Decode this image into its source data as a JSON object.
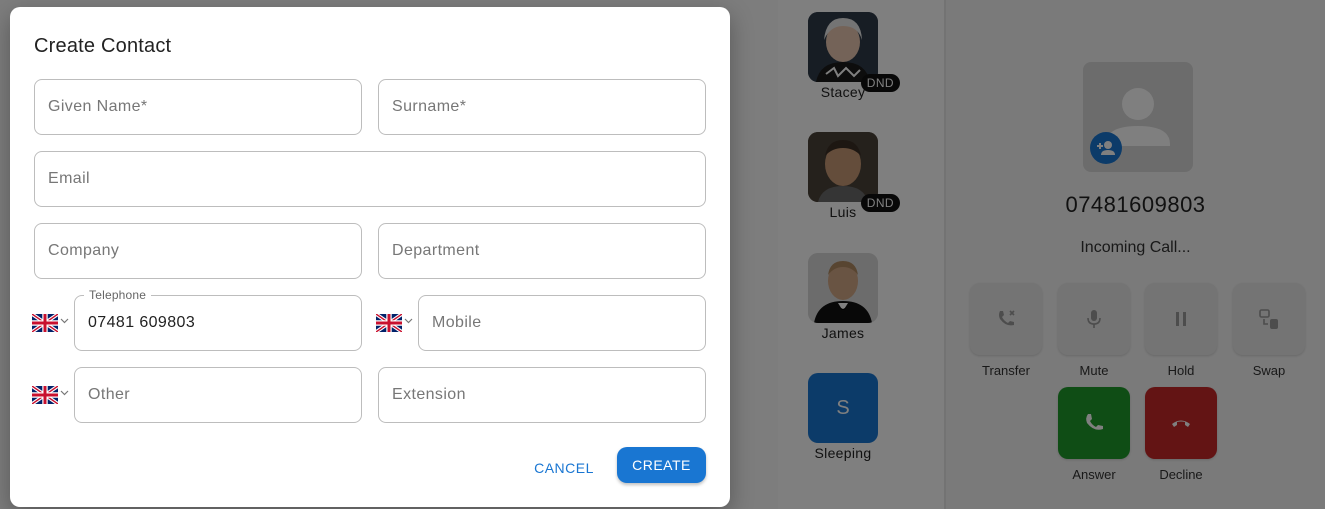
{
  "dialog": {
    "title": "Create Contact",
    "fields": {
      "given_name": {
        "placeholder": "Given Name*",
        "value": ""
      },
      "surname": {
        "placeholder": "Surname*",
        "value": ""
      },
      "email": {
        "placeholder": "Email",
        "value": ""
      },
      "company": {
        "placeholder": "Company",
        "value": ""
      },
      "department": {
        "placeholder": "Department",
        "value": ""
      },
      "telephone": {
        "label": "Telephone",
        "value": "07481 609803"
      },
      "mobile": {
        "placeholder": "Mobile",
        "value": ""
      },
      "other": {
        "placeholder": "Other",
        "value": ""
      },
      "extension": {
        "placeholder": "Extension",
        "value": ""
      }
    },
    "country_flag": "uk-flag-icon",
    "cancel_label": "CANCEL",
    "create_label": "CREATE"
  },
  "contacts": [
    {
      "name": "Stacey",
      "badge": "DND"
    },
    {
      "name": "Luis",
      "badge": "DND"
    },
    {
      "name": "James",
      "badge": ""
    },
    {
      "name": "Sleeping",
      "initial": "S"
    }
  ],
  "call": {
    "number": "07481609803",
    "status": "Incoming Call...",
    "controls": [
      "Transfer",
      "Mute",
      "Hold",
      "Swap"
    ],
    "answer_label": "Answer",
    "decline_label": "Decline"
  },
  "colors": {
    "accent": "#1976d2",
    "answer": "#1e9a2b",
    "decline": "#c62828",
    "dnd_badge": "#111111"
  }
}
